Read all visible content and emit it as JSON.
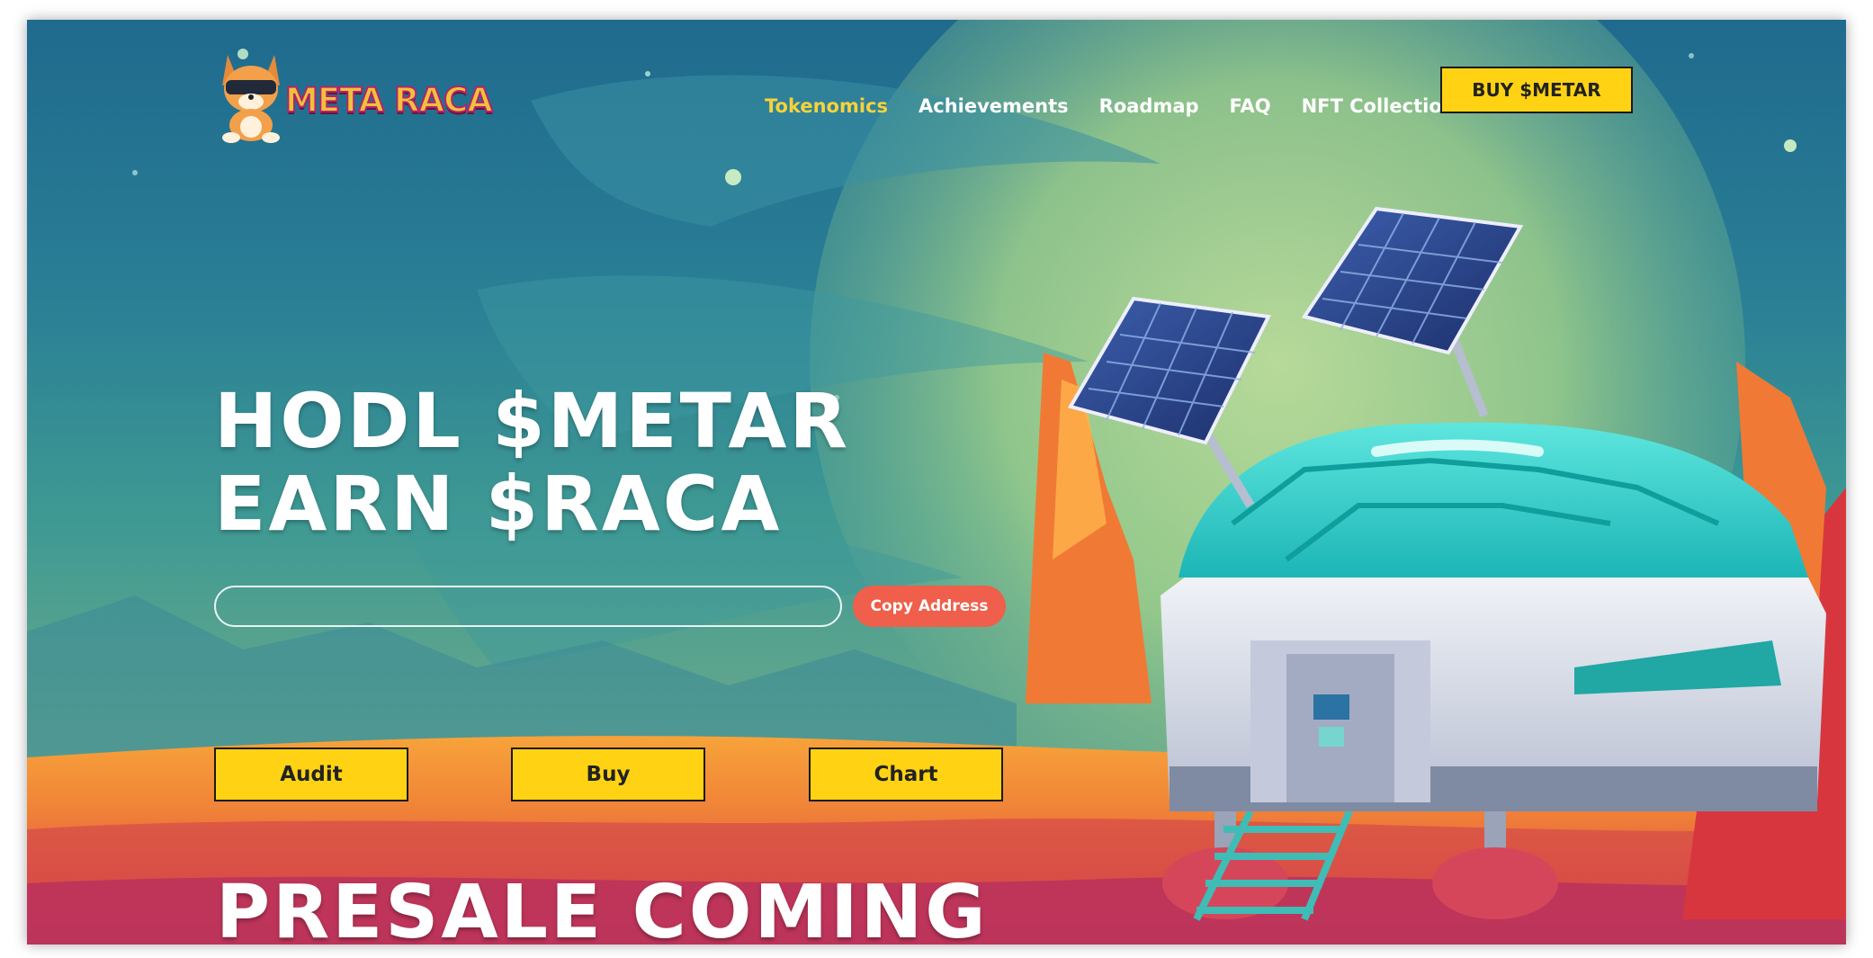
{
  "brand": {
    "logo_text": "META RACA",
    "colors": {
      "accent": "#ffd313",
      "copy_button": "#ef5f4b",
      "active_nav": "#f6d23a"
    }
  },
  "nav": {
    "links": [
      {
        "label": "Tokenomics",
        "active": true
      },
      {
        "label": "Achievements",
        "active": false
      },
      {
        "label": "Roadmap",
        "active": false
      },
      {
        "label": "FAQ",
        "active": false
      },
      {
        "label": "NFT Collection",
        "active": false
      }
    ],
    "buy_label": "BUY $METAR"
  },
  "hero": {
    "title_line1": "HODL $METAR",
    "title_line2": "EARN $RACA",
    "address_value": "",
    "copy_label": "Copy Address"
  },
  "actions": [
    {
      "label": "Audit"
    },
    {
      "label": "Buy"
    },
    {
      "label": "Chart"
    }
  ],
  "presale_text": "PRESALE COMING",
  "icons": {
    "logo": "shiba-astronaut-logo",
    "illustration": "space-base-illustration"
  }
}
